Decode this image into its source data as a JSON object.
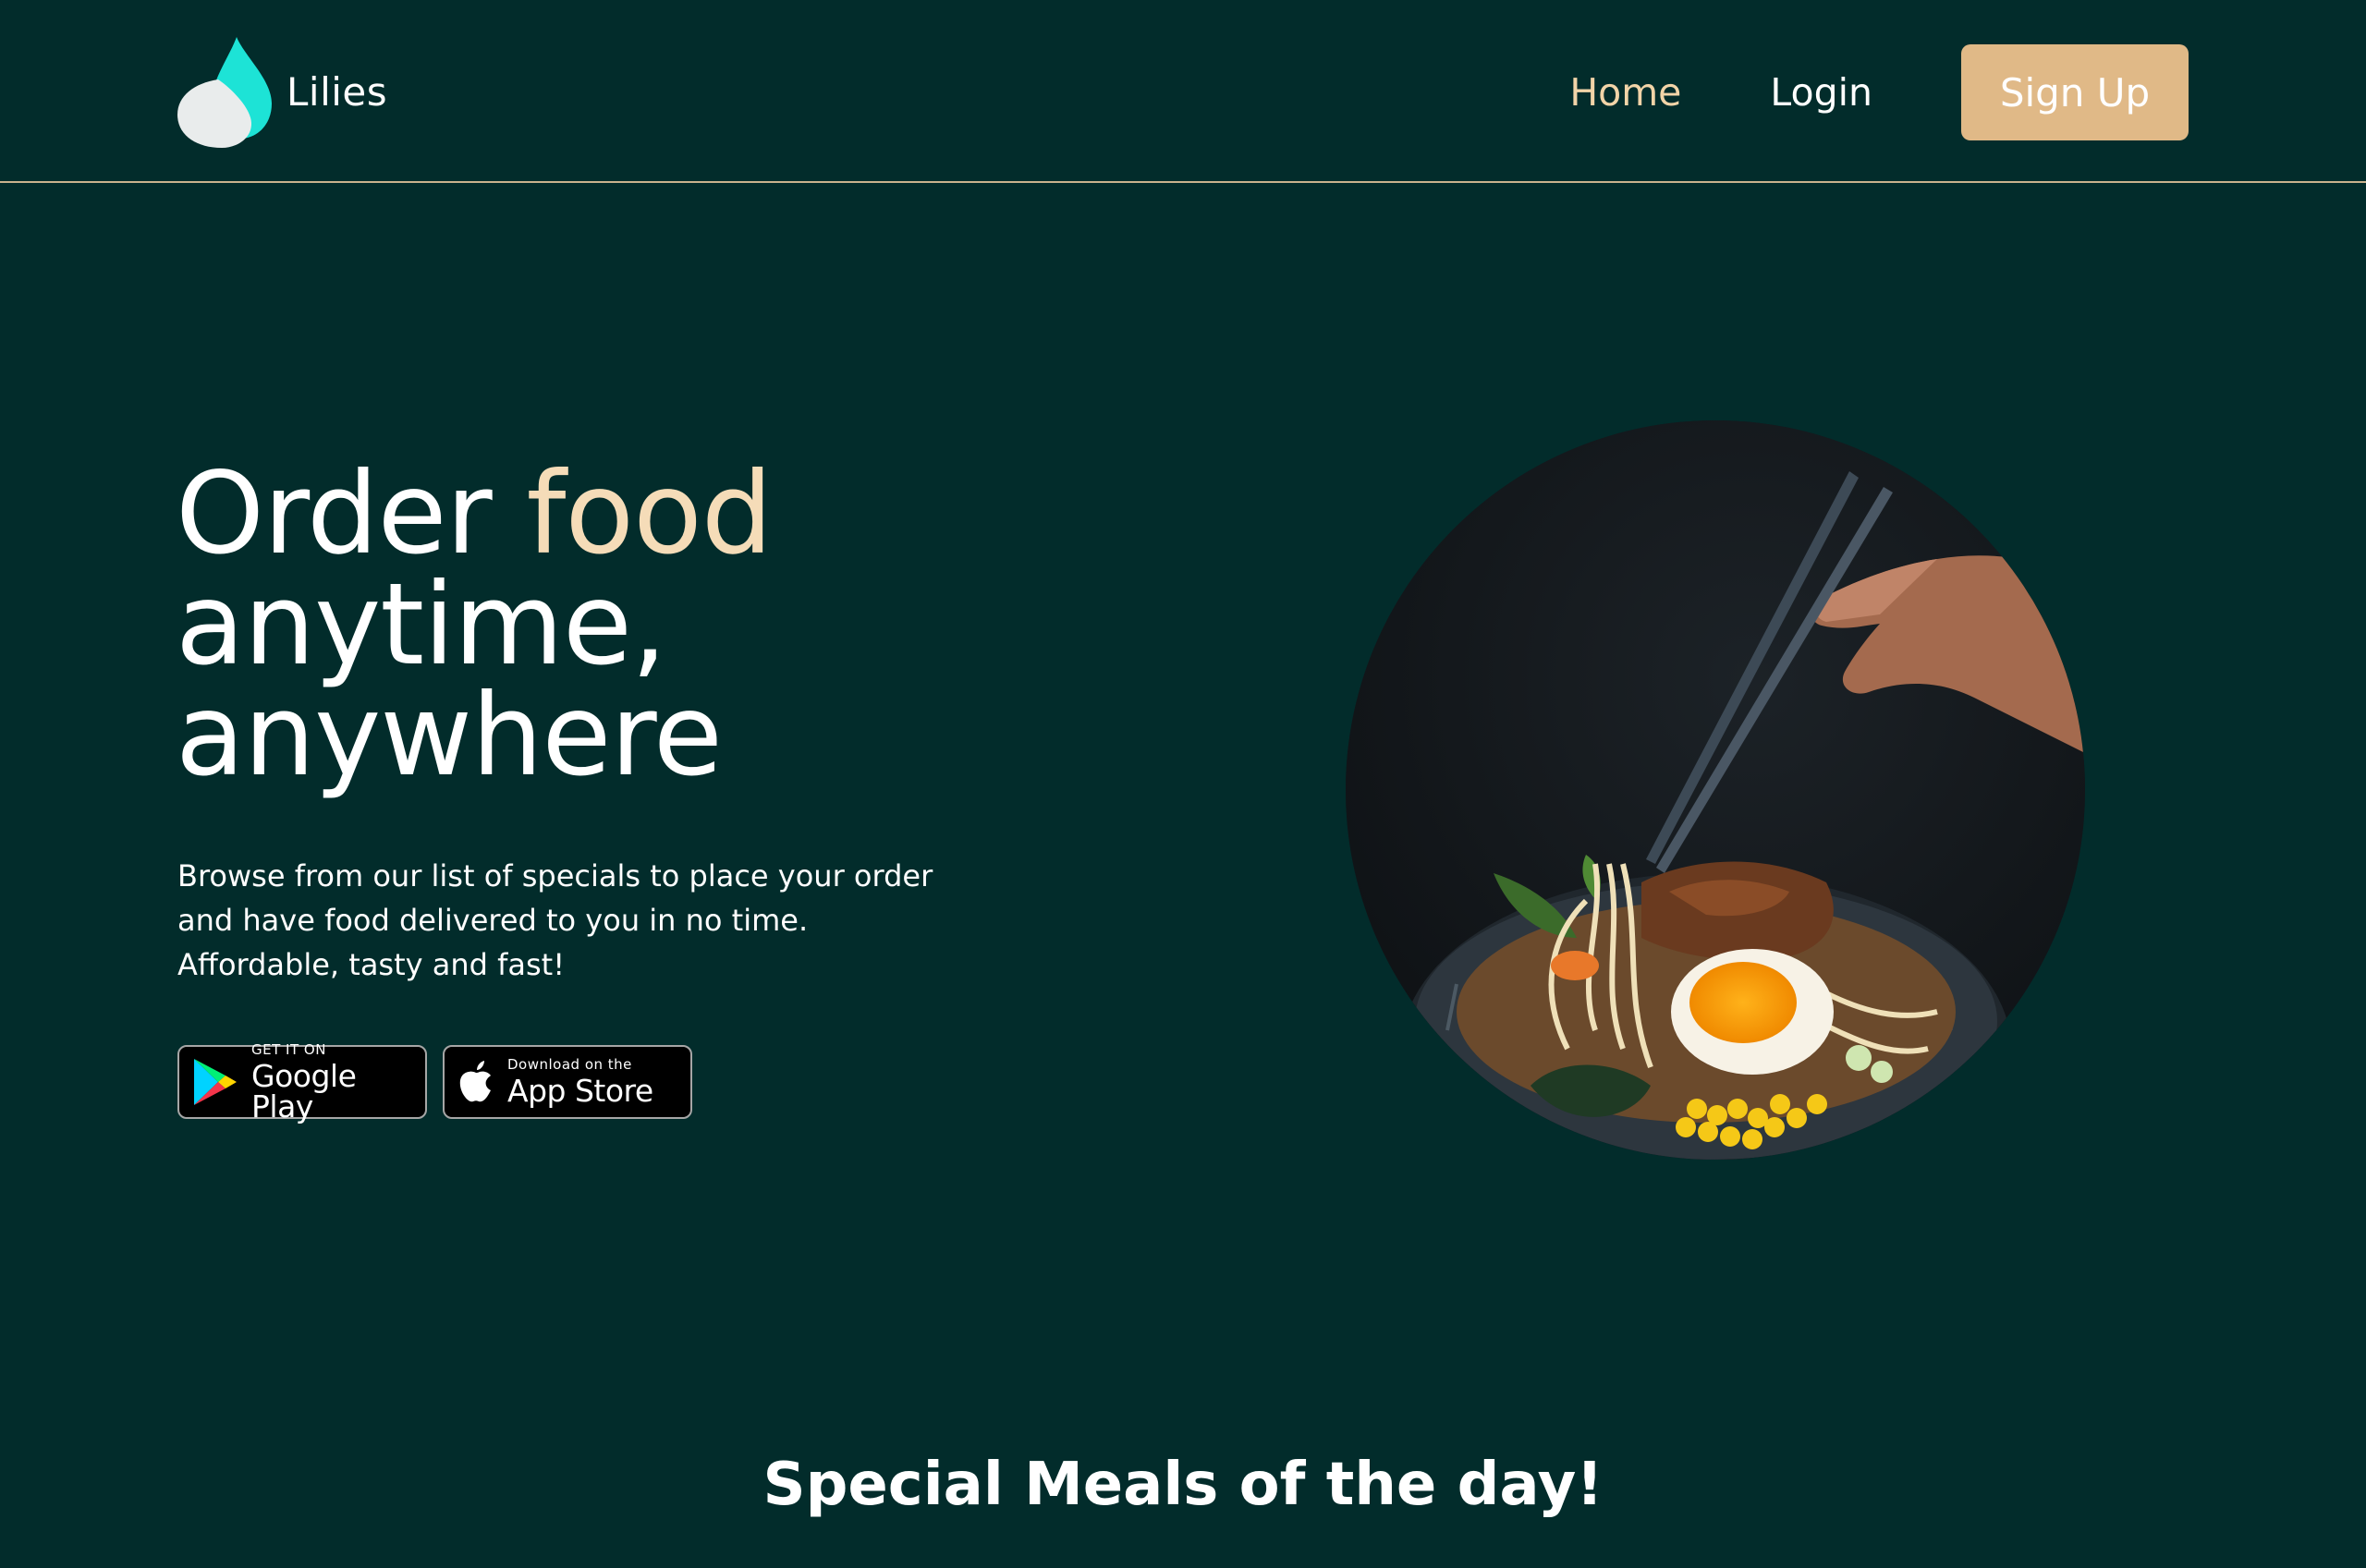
{
  "brand": {
    "name": "Lilies",
    "logo_icon": "drop-logo-icon"
  },
  "nav": {
    "home": "Home",
    "login": "Login",
    "signup": "Sign Up"
  },
  "hero": {
    "title_part1": "Order ",
    "title_accent": "food",
    "title_line2": "anytime,",
    "title_line3": "anywhere",
    "description_line1": "Browse from our list of specials to place your order",
    "description_line2": "and have food delivered to you in no time.",
    "description_line3": "Affordable, tasty and fast!",
    "image_alt": "ramen-bowl-photo"
  },
  "stores": {
    "google_small": "GET IT ON",
    "google_big": "Google Play",
    "apple_small": "Download on the",
    "apple_big": "App Store"
  },
  "section": {
    "title": "Special Meals of the day!"
  },
  "colors": {
    "background": "#022c2b",
    "accent": "#f5dcb8",
    "button": "#e0b987",
    "nav_active": "#f2d4a8",
    "logo_teal": "#1de3d6"
  }
}
